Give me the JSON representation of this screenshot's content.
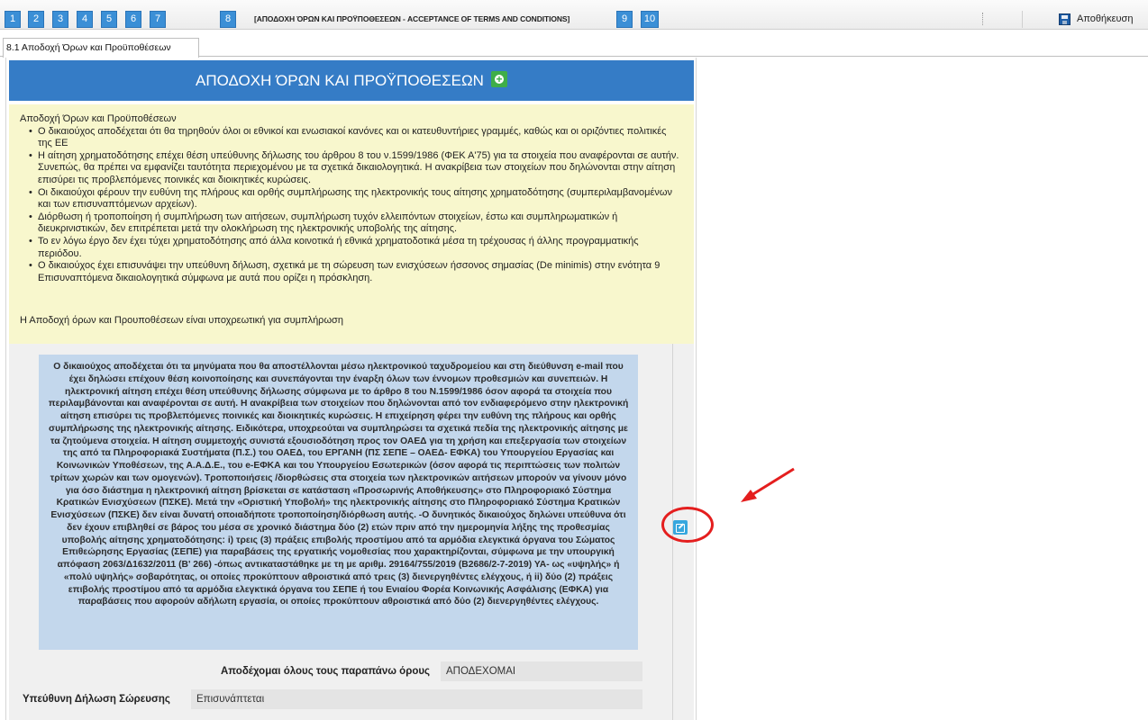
{
  "stepbar": {
    "steps": [
      "1",
      "2",
      "3",
      "4",
      "5",
      "6",
      "7",
      "8",
      "9",
      "10"
    ],
    "active_label": "[ΑΠΟΔΟΧΗ ΌΡΩΝ ΚΑΙ ΠΡΟΫΠΟΘΕΣΕΩΝ - ACCEPTANCE OF TERMS AND CONDITIONS]",
    "save_label": "Αποθήκευση"
  },
  "tab": {
    "label": "8.1 Αποδοχή Όρων και Προϋποθέσεων"
  },
  "header": {
    "title": "ΑΠΟΔΟΧΗ ΌΡΩΝ ΚΑΙ ΠΡΟΫΠΟΘΕΣΕΩΝ",
    "icon": "plus-circle-icon"
  },
  "terms": {
    "title": "Αποδοχή Όρων και Προϋποθέσεων",
    "items": [
      "Ο δικαιούχος αποδέχεται ότι θα τηρηθούν όλοι οι εθνικοί και ενωσιακοί κανόνες και οι κατευθυντήριες γραμμές, καθώς και οι οριζόντιες πολιτικές της ΕΕ",
      "Η αίτηση χρηματοδότησης επέχει θέση υπεύθυνης δήλωσης του άρθρου 8 του ν.1599/1986 (ΦΕΚ Α'75) για τα στοιχεία που αναφέρονται σε αυτήν. Συνεπώς, θα πρέπει να εμφανίζει ταυτότητα περιεχομένου με τα σχετικά δικαιολογητικά. Η ανακρίβεια των στοιχείων που δηλώνονται στην αίτηση επισύρει τις προβλεπόμενες ποινικές και διοικητικές κυρώσεις.",
      "Οι δικαιούχοι φέρουν την ευθύνη της πλήρους και ορθής συμπλήρωσης της ηλεκτρονικής τους αίτησης χρηματοδότησης (συμπεριλαμβανομένων και των επισυναπτόμενων αρχείων).",
      "Διόρθωση ή τροποποίηση ή συμπλήρωση των αιτήσεων, συμπλήρωση τυχόν ελλειπόντων στοιχείων, έστω και συμπληρωματικών ή διευκρινιστικών, δεν επιτρέπεται μετά την ολοκλήρωση της ηλεκτρονικής υποβολής της αίτησης.",
      "Το εν λόγω έργο δεν έχει τύχει χρηματοδότησης από άλλα κοινοτικά ή εθνικά χρηματοδοτικά μέσα τη τρέχουσας ή άλλης προγραμματικής περιόδου.",
      "Ο δικαιούχος έχει επισυνάψει την υπεύθυνη δήλωση, σχετικά με τη σώρευση των ενισχύσεων ήσσονος σημασίας (De minimis) στην ενότητα 9 Επισυναπτόμενα δικαιολογητικά σύμφωνα με αυτά που ορίζει η πρόσκληση."
    ],
    "mandatory_note": "Η Αποδοχή όρων και Προυποθέσεων είναι υποχρεωτική για συμπλήρωση"
  },
  "declaration": {
    "text": "Ο δικαιούχος αποδέχεται ότι τα μηνύματα που θα αποστέλλονται μέσω ηλεκτρονικού ταχυδρομείου και στη διεύθυνση e-mail που έχει δηλώσει επέχουν θέση κοινοποίησης και συνεπάγονται την έναρξη όλων των έννομων προθεσμιών και συνεπειών. Η ηλεκτρονική αίτηση επέχει θέση υπεύθυνης δήλωσης σύμφωνα με το άρθρο 8 του Ν.1599/1986 όσον αφορά τα στοιχεία που περιλαμβάνονται και αναφέρονται σε αυτή. Η ανακρίβεια των στοιχείων που δηλώνονται από τον ενδιαφερόμενο στην ηλεκτρονική αίτηση επισύρει τις προβλεπόμενες ποινικές και διοικητικές κυρώσεις. Η επιχείρηση φέρει την ευθύνη της πλήρους και ορθής συμπλήρωσης της ηλεκτρονικής αίτησης. Ειδικότερα, υποχρεούται να συμπληρώσει τα σχετικά πεδία της ηλεκτρονικής αίτησης με τα ζητούμενα στοιχεία. Η αίτηση συμμετοχής συνιστά εξουσιοδότηση προς τον ΟΑΕΔ για τη χρήση και επεξεργασία των στοιχείων της από τα Πληροφοριακά Συστήματα (Π.Σ.) του ΟΑΕΔ, του ΕΡΓΑΝΗ (ΠΣ ΣΕΠΕ – ΟΑΕΔ- ΕΦΚΑ) του Υπουργείου Εργασίας και Κοινωνικών Υποθέσεων, της Α.Α.Δ.Ε., του e-ΕΦΚΑ και του Υπουργείου Εσωτερικών (όσον αφορά τις περιπτώσεις των πολιτών τρίτων χωρών και των ομογενών). Τροποποιήσεις /διορθώσεις στα στοιχεία των ηλεκτρονικών αιτήσεων μπορούν να γίνουν μόνο για όσο διάστημα η ηλεκτρονική αίτηση βρίσκεται σε κατάσταση «Προσωρινής Αποθήκευσης» στο Πληροφοριακό Σύστημα Κρατικών Ενισχύσεων (ΠΣΚΕ). Μετά την «Οριστική Υποβολή» της ηλεκτρονικής αίτησης στο Πληροφοριακό Σύστημα Κρατικών Ενισχύσεων (ΠΣΚΕ) δεν είναι δυνατή οποιαδήποτε τροποποίηση/διόρθωση αυτής. -Ο δυνητικός δικαιούχος δηλώνει υπεύθυνα ότι δεν έχουν επιβληθεί σε βάρος του μέσα σε χρονικό διάστημα δύο (2) ετών πριν από την ημερομηνία λήξης της προθεσμίας υποβολής αίτησης χρηματοδότησης: i) τρεις (3) πράξεις επιβολής προστίμου από τα αρμόδια ελεγκτικά όργανα του Σώματος Επιθεώρησης Εργασίας (ΣΕΠΕ) για παραβάσεις της εργατικής νομοθεσίας που χαρακτηρίζονται, σύμφωνα με την υπουργική απόφαση 2063/Δ1632/2011 (Β' 266) -όπως αντικαταστάθηκε με τη με αριθμ. 29164/755/2019 (Β2686/2-7-2019) ΥΑ- ως «υψηλής» ή «πολύ υψηλής» σοβαρότητας, οι οποίες προκύπτουν αθροιστικά από τρεις (3) διενεργηθέντες ελέγχους, ή ii) δύο (2) πράξεις επιβολής προστίμου από τα αρμόδια ελεγκτικά όργανα του ΣΕΠΕ ή του Ενιαίου Φορέα Κοινωνικής Ασφάλισης (ΕΦΚΑ) για παραβάσεις που αφορούν αδήλωτη εργασία, οι οποίες προκύπτουν αθροιστικά από δύο (2) διενεργηθέντες ελέγχους.",
    "accept_label": "Αποδέχομαι όλους τους παραπάνω όρους",
    "accept_value": "ΑΠΟΔΕΧΟΜΑΙ",
    "cumulation_label": "Υπεύθυνη Δήλωση Σώρευσης",
    "cumulation_value": "Επισυνάπτεται",
    "edit_icon": "edit-icon"
  },
  "colors": {
    "step_blue": "#3b8fd6",
    "header_blue": "#357cc6",
    "terms_bg": "#f8f7cd",
    "declaration_bg": "#c3d7ec",
    "annotation_red": "#e41e1e"
  }
}
